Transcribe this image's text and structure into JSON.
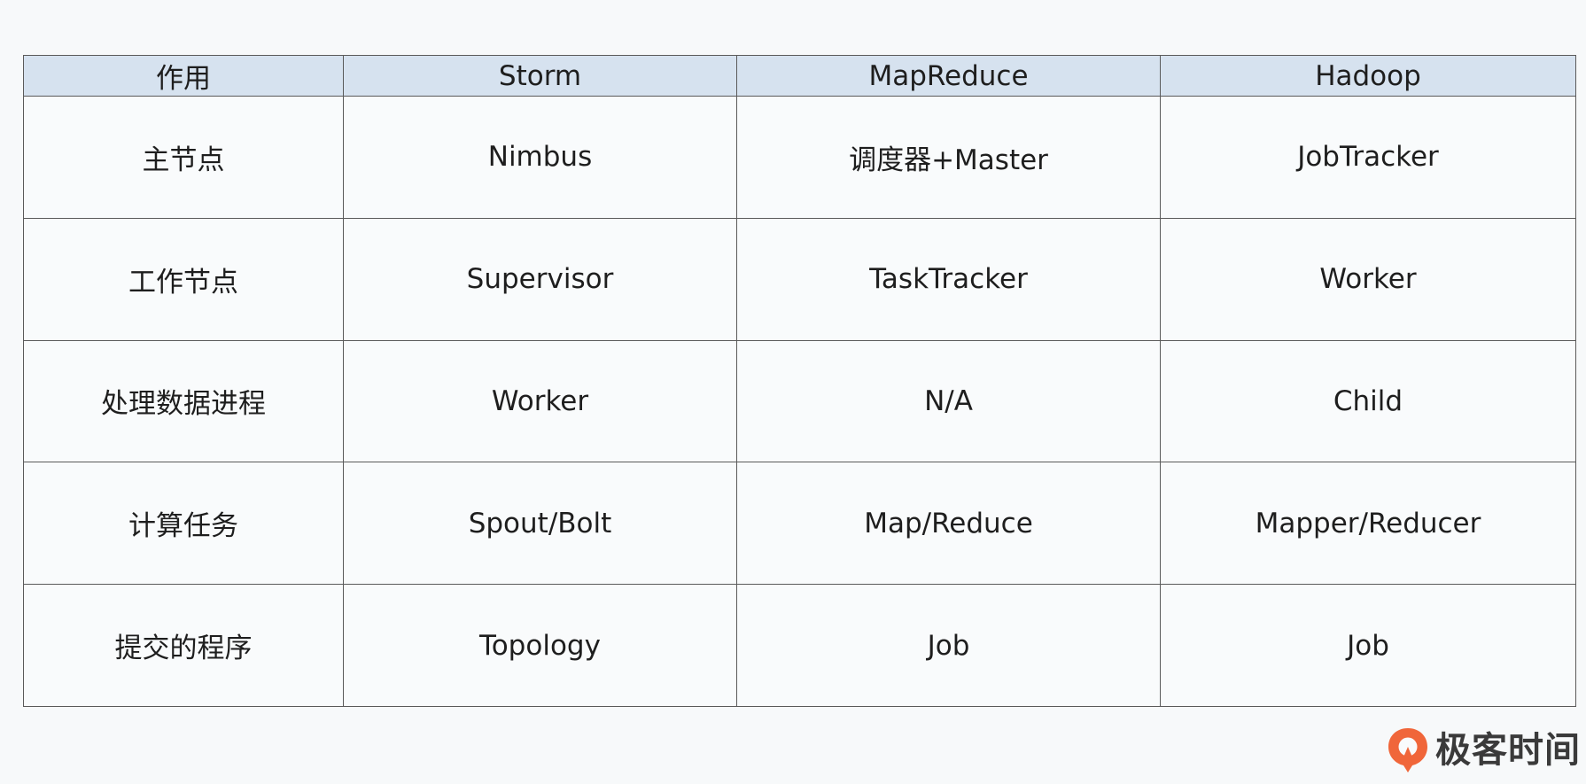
{
  "table": {
    "headers": [
      "作用",
      "Storm",
      "MapReduce",
      "Hadoop"
    ],
    "rows": [
      [
        "主节点",
        "Nimbus",
        "调度器+Master",
        "JobTracker"
      ],
      [
        "工作节点",
        "Supervisor",
        "TaskTracker",
        "Worker"
      ],
      [
        "处理数据进程",
        "Worker",
        "N/A",
        "Child"
      ],
      [
        "计算任务",
        "Spout/Bolt",
        "Map/Reduce",
        "Mapper/Reducer"
      ],
      [
        "提交的程序",
        "Topology",
        "Job",
        "Job"
      ]
    ]
  },
  "brand": {
    "name": "极客时间",
    "logo_icon": "geektime-logo-icon",
    "logo_color": "#f0663a"
  }
}
